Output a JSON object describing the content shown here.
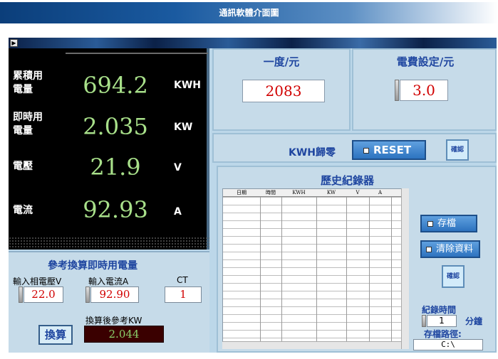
{
  "banner": {
    "title": "通訊軟體介面圖"
  },
  "meter": {
    "rows": [
      {
        "label_line1": "累積用",
        "label_line2": "電量",
        "value": "694.2",
        "unit": "KWH"
      },
      {
        "label_line1": "即時用",
        "label_line2": "電量",
        "value": "2.035",
        "unit": "KW"
      },
      {
        "label_line1": "電壓",
        "label_line2": "",
        "value": "21.9",
        "unit": "V"
      },
      {
        "label_line1": "電流",
        "label_line2": "",
        "value": "92.93",
        "unit": "A"
      }
    ]
  },
  "reference": {
    "title": "參考換算即時用電量",
    "voltage_label": "輸入相電壓V",
    "voltage_value": "22.0",
    "current_label": "輸入電流A",
    "current_value": "92.90",
    "ct_label": "CT",
    "ct_value": "1",
    "convert_label": "換算",
    "result_label": "換算後參考KW",
    "result_value": "2.044"
  },
  "price": {
    "title": "一度/元",
    "value": "2083"
  },
  "setting": {
    "title": "電費設定/元",
    "value": "3.0"
  },
  "reset_panel": {
    "label": "KWH歸零",
    "reset_label": "RESET",
    "confirm_label": "確認"
  },
  "history": {
    "title": "歷史紀錄器",
    "columns": [
      "日期",
      "時間",
      "KWH",
      "KW",
      "V",
      "A"
    ],
    "save_label": "存檔",
    "clear_label": "清除資料",
    "confirm_label": "確認",
    "record_interval_label": "紀錄時間",
    "record_interval_value": "1",
    "record_interval_unit": "分鐘",
    "save_path_label": "存檔路徑:",
    "save_path_value": "C:\\"
  }
}
